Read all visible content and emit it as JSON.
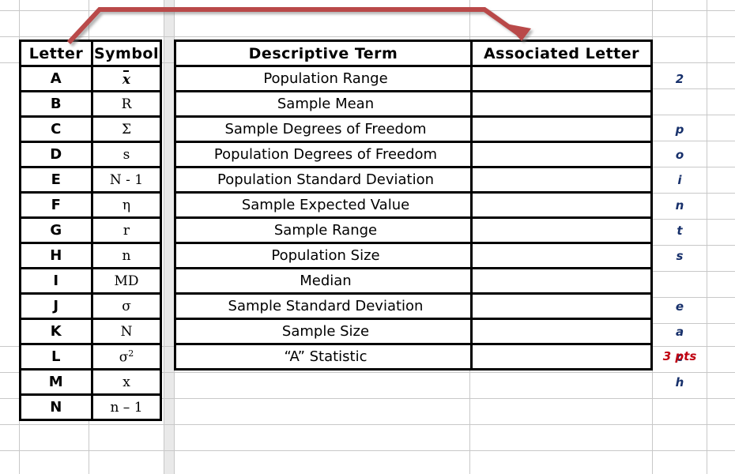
{
  "worksheet": {
    "background": "#ffffff",
    "gridline_color": "#c8c8c8"
  },
  "letter_table": {
    "headers": {
      "letter": "Letter",
      "symbol": "Symbol"
    },
    "rows": [
      {
        "letter": "A",
        "symbol": "x̄",
        "symbol_kind": "x-bar"
      },
      {
        "letter": "B",
        "symbol": "R",
        "symbol_kind": "plain"
      },
      {
        "letter": "C",
        "symbol": "Σ",
        "symbol_kind": "plain"
      },
      {
        "letter": "D",
        "symbol": "s",
        "symbol_kind": "plain"
      },
      {
        "letter": "E",
        "symbol": "N - 1",
        "symbol_kind": "plain"
      },
      {
        "letter": "F",
        "symbol": "η",
        "symbol_kind": "plain"
      },
      {
        "letter": "G",
        "symbol": "r",
        "symbol_kind": "plain"
      },
      {
        "letter": "H",
        "symbol": "n",
        "symbol_kind": "plain"
      },
      {
        "letter": "I",
        "symbol": "MD",
        "symbol_kind": "plain"
      },
      {
        "letter": "J",
        "symbol": "σ",
        "symbol_kind": "plain"
      },
      {
        "letter": "K",
        "symbol": "N",
        "symbol_kind": "plain"
      },
      {
        "letter": "L",
        "symbol": "σ",
        "symbol_kind": "superscript",
        "superscript": "2"
      },
      {
        "letter": "M",
        "symbol": "x",
        "symbol_kind": "plain"
      },
      {
        "letter": "N",
        "symbol": "n – 1",
        "symbol_kind": "plain"
      }
    ]
  },
  "term_table": {
    "headers": {
      "term": "Descriptive Term",
      "associated": "Associated Letter"
    },
    "rows": [
      {
        "term": "Population Range",
        "associated": ""
      },
      {
        "term": "Sample Mean",
        "associated": ""
      },
      {
        "term": "Sample Degrees of Freedom",
        "associated": ""
      },
      {
        "term": "Population Degrees of Freedom",
        "associated": ""
      },
      {
        "term": "Population Standard Deviation",
        "associated": ""
      },
      {
        "term": "Sample Expected Value",
        "associated": ""
      },
      {
        "term": "Sample Range",
        "associated": ""
      },
      {
        "term": "Population Size",
        "associated": ""
      },
      {
        "term": "Median",
        "associated": ""
      },
      {
        "term": "Sample Standard Deviation",
        "associated": ""
      },
      {
        "term": "Sample Size",
        "associated": ""
      },
      {
        "term": "“A” Statistic",
        "associated": ""
      }
    ]
  },
  "annotations": {
    "points_vertical": [
      "2",
      "",
      "p",
      "o",
      "i",
      "n",
      "t",
      "s",
      "",
      "e",
      "a",
      "c",
      "h"
    ],
    "points_text": "2 points each",
    "points_color": "#17306b",
    "three_pts": "3 pts",
    "three_pts_color": "#c00010",
    "arrow_color": "#b94a4a",
    "arrow_description": "red arrow from Letter column to Associated Letter column"
  }
}
